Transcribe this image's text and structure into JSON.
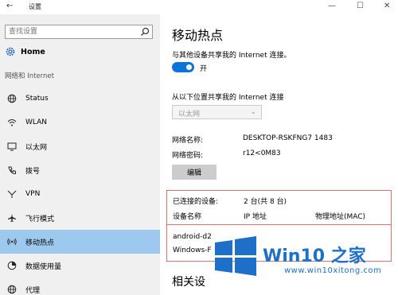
{
  "window": {
    "back_glyph": "←",
    "title": "设置",
    "minimize_glyph": "—",
    "maximize_glyph": "☐",
    "close_glyph": "✕"
  },
  "sidebar": {
    "search_placeholder": "查找设置",
    "home_label": "Home",
    "section_header": "网络和 Internet",
    "items": [
      {
        "label": "Status",
        "icon": "globe-icon"
      },
      {
        "label": "WLAN",
        "icon": "wifi-icon"
      },
      {
        "label": "以太网",
        "icon": "monitor-icon"
      },
      {
        "label": "拨号",
        "icon": "phone-icon"
      },
      {
        "label": "VPN",
        "icon": "vpn-icon"
      },
      {
        "label": "飞行模式",
        "icon": "airplane-icon"
      },
      {
        "label": "移动热点",
        "icon": "hotspot-icon",
        "active": true
      },
      {
        "label": "数据使用量",
        "icon": "data-usage-icon"
      },
      {
        "label": "代理",
        "icon": "globe-icon"
      }
    ]
  },
  "main": {
    "title": "移动热点",
    "share_label": "与其他设备共享我的 Internet 连接。",
    "toggle_state": "开",
    "share_from_label": "从以下位置共享我的 Internet 连接",
    "share_from_value": "以太网",
    "network_name_label": "网络名称:",
    "network_name_value": "DESKTOP-RSKFNG7 1483",
    "network_password_label": "网络密码:",
    "network_password_value": "r12<0M83",
    "edit_button": "编辑",
    "connected_label": "已连接的设备:",
    "connected_count": "2 台(共 8 台)",
    "columns": [
      "设备名称",
      "IP 地址",
      "物理地址(MAC)"
    ],
    "devices": [
      "android-d2",
      "Windows-F"
    ],
    "related_heading": "相关设"
  },
  "watermark": {
    "title": "Win10 之家",
    "url": "www.win10xitong.com",
    "color": "#1d6fc7"
  },
  "colors": {
    "accent": "#0a74d8",
    "active_nav": "#9ec9ee",
    "highlight_border": "#e07070"
  }
}
